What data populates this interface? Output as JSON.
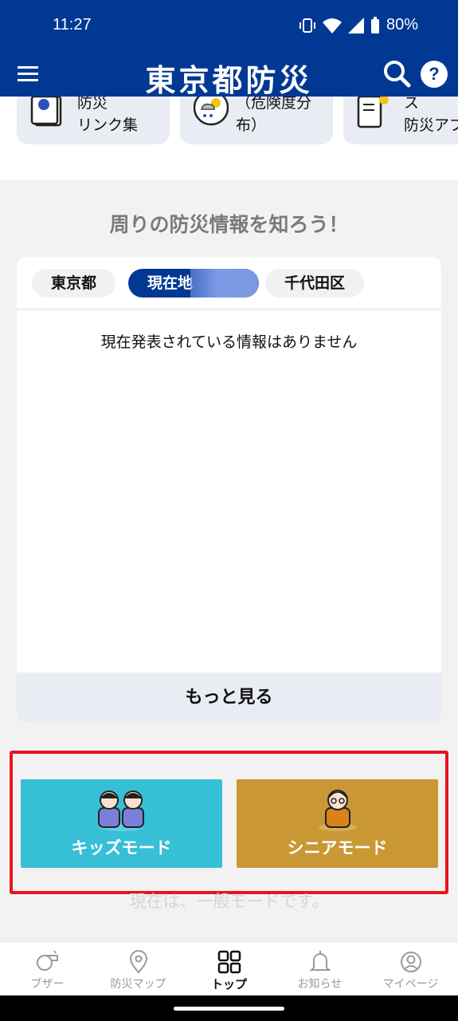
{
  "status_bar": {
    "time": "11:27",
    "battery": "80%"
  },
  "header": {
    "title": "東京都防災"
  },
  "shortcuts": [
    {
      "label": "防災\nリンク集"
    },
    {
      "label": "（危険度分\n布）"
    },
    {
      "label": "ス\n防災アプ"
    }
  ],
  "section": {
    "title": "周りの防災情報を知ろう！"
  },
  "tabs": [
    {
      "label": "東京都"
    },
    {
      "label": "現在地"
    },
    {
      "label": "千代田区"
    }
  ],
  "info": {
    "empty_message": "現在発表されている情報はありません",
    "more_label": "もっと見る"
  },
  "modes": {
    "kids_label": "キッズモード",
    "senior_label": "シニアモード",
    "current_note": "現在は、一般モードです。",
    "kids_color": "#37bfd6",
    "senior_color": "#c99835"
  },
  "bottom_nav": [
    {
      "label": "ブザー",
      "icon": "whistle-icon"
    },
    {
      "label": "防災マップ",
      "icon": "map-pin-icon"
    },
    {
      "label": "トップ",
      "icon": "grid-icon"
    },
    {
      "label": "お知らせ",
      "icon": "bell-icon"
    },
    {
      "label": "マイページ",
      "icon": "user-circle-icon"
    }
  ],
  "colors": {
    "brand": "#003893",
    "highlight": "#e8141b"
  }
}
